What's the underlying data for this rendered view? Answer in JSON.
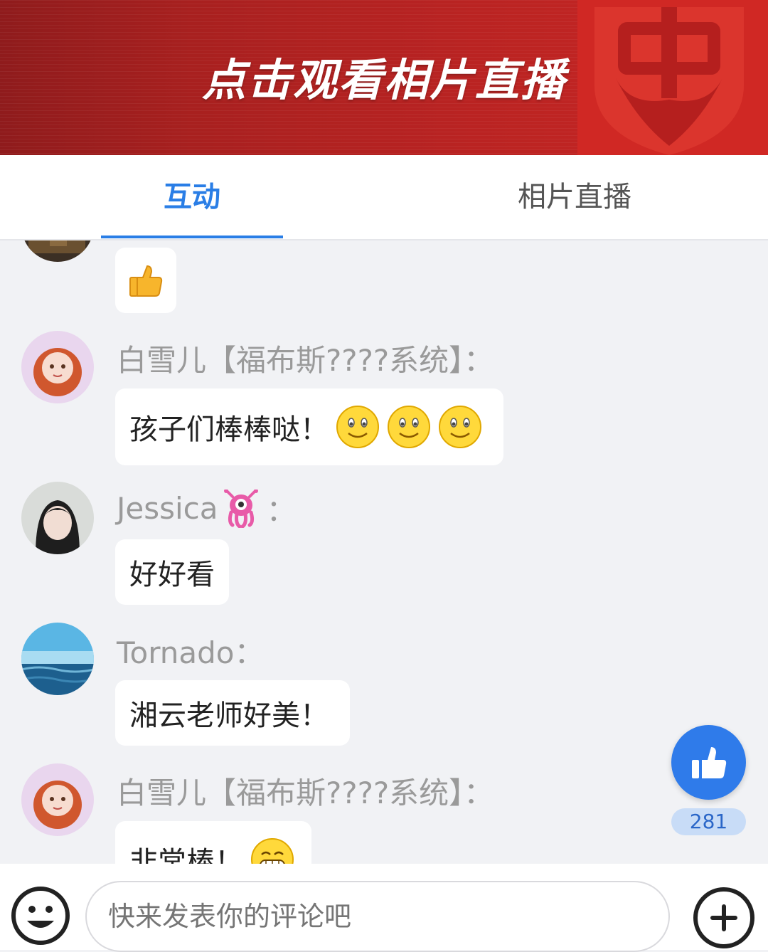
{
  "banner": {
    "title": "点击观看相片直播"
  },
  "tabs": [
    {
      "label": "互动",
      "active": true
    },
    {
      "label": "相片直播",
      "active": false
    }
  ],
  "colors": {
    "accent": "#2a7ee6",
    "banner_red": "#b92322",
    "like_blue": "#2f7bea"
  },
  "messages": [
    {
      "user": "",
      "text": "",
      "emoji": "thumbs-up"
    },
    {
      "user": "白雪儿【福布斯????系统】：",
      "text": "孩子们棒棒哒！",
      "emoji": "smiley-x3"
    },
    {
      "user": "Jessica",
      "user_suffix": "：",
      "user_emoji": "alien-octopus",
      "text": "好好看"
    },
    {
      "user": "Tornado：",
      "text": "湘云老师好美！"
    },
    {
      "user": "白雪儿【福布斯????系统】：",
      "text": "非常棒！",
      "emoji": "grin"
    }
  ],
  "like": {
    "count": "281"
  },
  "composer": {
    "placeholder": "快来发表你的评论吧"
  }
}
